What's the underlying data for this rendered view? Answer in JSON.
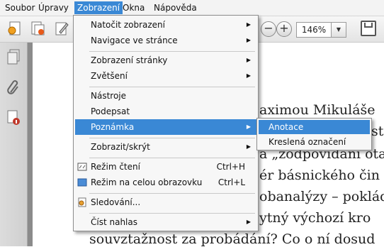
{
  "menubar": {
    "items": [
      "Soubor",
      "Úpravy",
      "Zobrazení",
      "Okna",
      "Nápověda"
    ],
    "active_index": 2
  },
  "toolbar": {
    "zoom_value": "146%",
    "icons": [
      "create-pdf-icon",
      "combine-icon",
      "edit-icon",
      "zoom-out-icon",
      "zoom-in-icon",
      "zoom-dropdown-icon",
      "save-icon"
    ]
  },
  "sidebar": {
    "icons": [
      "pages-icon",
      "attachment-icon",
      "document-info-icon"
    ]
  },
  "document": {
    "lines": [
      "aximou Mikuláše",
      "st",
      "a „zodpovídání ota",
      "ér básnického čin",
      "obanalýzy – poklád",
      "ytný výchozí kro",
      "souvztažnost za probádání? Co o ní dosud"
    ]
  },
  "menu": {
    "items": [
      {
        "label": "Natočit zobrazení",
        "submenu": true
      },
      {
        "label": "Navigace ve stránce",
        "submenu": true
      },
      {
        "label": "Zobrazení stránky",
        "submenu": true
      },
      {
        "label": "Zvětšení",
        "submenu": true
      },
      {
        "label": "Nástroje",
        "submenu": false
      },
      {
        "label": "Podepsat",
        "submenu": false
      },
      {
        "label": "Poznámka",
        "submenu": true,
        "highlighted": true
      },
      {
        "label": "Zobrazit/skrýt",
        "submenu": true
      },
      {
        "label": "Režim čtení",
        "shortcut": "Ctrl+H",
        "icon": "reading-mode-icon"
      },
      {
        "label": "Režim na celou obrazovku",
        "shortcut": "Ctrl+L",
        "icon": "fullscreen-icon"
      },
      {
        "label": "Sledování...",
        "icon": "tracking-icon"
      },
      {
        "label": "Číst nahlas",
        "submenu": true
      }
    ]
  },
  "submenu": {
    "items": [
      {
        "label": "Anotace",
        "highlighted": true
      },
      {
        "label": "Kreslená označení"
      }
    ]
  },
  "colors": {
    "highlight": "#3a88d5",
    "menu_bg": "#f7f7f7",
    "page_gray": "#8b8b8b"
  }
}
